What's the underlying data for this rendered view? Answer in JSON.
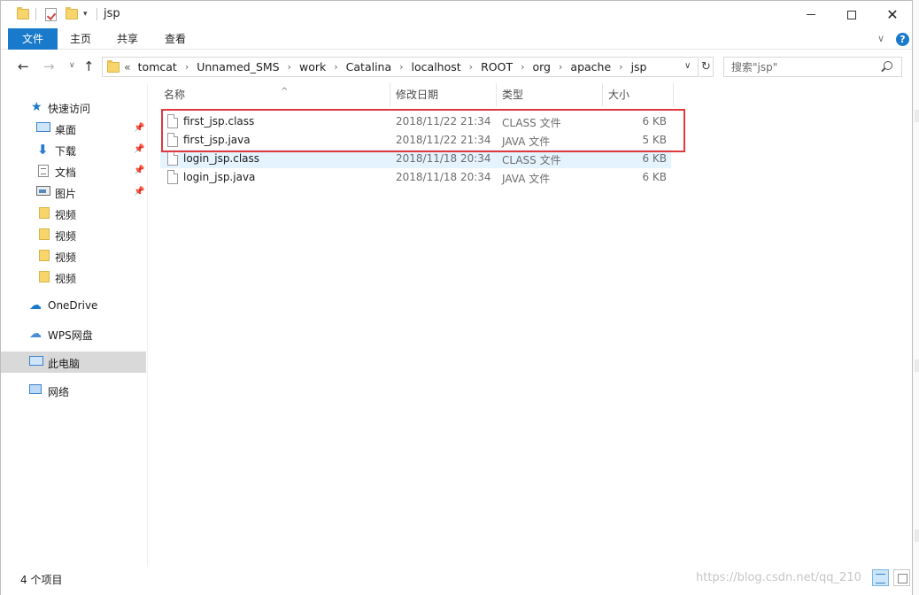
{
  "window": {
    "title": "jsp"
  },
  "ribbon": {
    "tabs": [
      {
        "label": "文件"
      },
      {
        "label": "主页"
      },
      {
        "label": "共享"
      },
      {
        "label": "查看"
      }
    ]
  },
  "address": {
    "lead": "«",
    "crumbs": [
      "tomcat",
      "Unnamed_SMS",
      "work",
      "Catalina",
      "localhost",
      "ROOT",
      "org",
      "apache",
      "jsp"
    ]
  },
  "search": {
    "placeholder": "搜索\"jsp\""
  },
  "sidebar": {
    "items": [
      {
        "label": "快速访问",
        "icon": "star-icon"
      },
      {
        "label": "桌面",
        "icon": "desktop-icon",
        "pinned": true
      },
      {
        "label": "下载",
        "icon": "download-icon",
        "pinned": true
      },
      {
        "label": "文档",
        "icon": "document-icon",
        "pinned": true
      },
      {
        "label": "图片",
        "icon": "pictures-icon",
        "pinned": true
      },
      {
        "label": "视频",
        "icon": "folder-icon"
      },
      {
        "label": "视频",
        "icon": "folder-icon"
      },
      {
        "label": "视频",
        "icon": "folder-icon"
      },
      {
        "label": "视频",
        "icon": "folder-icon"
      },
      {
        "label": "OneDrive",
        "icon": "onedrive-icon"
      },
      {
        "label": "WPS网盘",
        "icon": "wps-cloud-icon"
      },
      {
        "label": "此电脑",
        "icon": "this-pc-icon",
        "selected": true
      },
      {
        "label": "网络",
        "icon": "network-icon"
      }
    ]
  },
  "filelist": {
    "columns": {
      "name": "名称",
      "date": "修改日期",
      "type": "类型",
      "size": "大小"
    },
    "rows": [
      {
        "name": "first_jsp.class",
        "date": "2018/11/22 21:34",
        "type": "CLASS 文件",
        "size": "6 KB"
      },
      {
        "name": "first_jsp.java",
        "date": "2018/11/22 21:34",
        "type": "JAVA 文件",
        "size": "5 KB"
      },
      {
        "name": "login_jsp.class",
        "date": "2018/11/18 20:34",
        "type": "CLASS 文件",
        "size": "6 KB"
      },
      {
        "name": "login_jsp.java",
        "date": "2018/11/18 20:34",
        "type": "JAVA 文件",
        "size": "6 KB"
      }
    ]
  },
  "status": {
    "count": "4 个项目"
  },
  "watermark": "https://blog.csdn.net/qq_210"
}
